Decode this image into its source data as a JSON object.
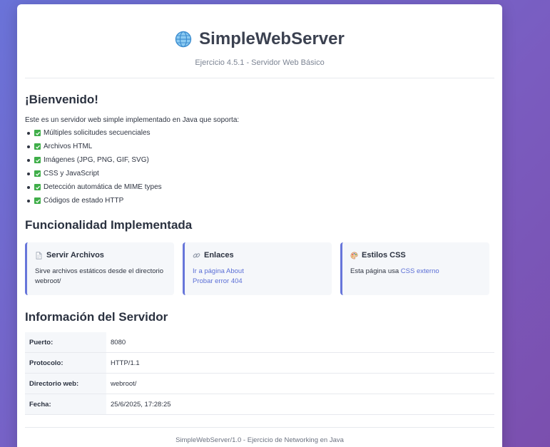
{
  "header": {
    "title": "SimpleWebServer",
    "subtitle": "Ejercicio 4.5.1 - Servidor Web Básico",
    "icon": "globe-icon"
  },
  "welcome": {
    "heading": "¡Bienvenido!",
    "intro": "Este es un servidor web simple implementado en Java que soporta:",
    "features": [
      "Múltiples solicitudes secuenciales",
      "Archivos HTML",
      "Imágenes (JPG, PNG, GIF, SVG)",
      "CSS y JavaScript",
      "Detección automática de MIME types",
      "Códigos de estado HTTP"
    ]
  },
  "functionality": {
    "heading": "Funcionalidad Implementada",
    "cards": [
      {
        "icon": "document-icon",
        "title": "Servir Archivos",
        "text": "Sirve archivos estáticos desde el directorio webroot/"
      },
      {
        "icon": "link-icon",
        "title": "Enlaces",
        "link1": "Ir a página About",
        "link2": "Probar error 404"
      },
      {
        "icon": "palette-icon",
        "title": "Estilos CSS",
        "text": "Esta página usa ",
        "link": "CSS externo"
      }
    ]
  },
  "server_info": {
    "heading": "Información del Servidor",
    "rows": [
      {
        "key": "Puerto:",
        "value": "8080"
      },
      {
        "key": "Protocolo:",
        "value": "HTTP/1.1"
      },
      {
        "key": "Directorio web:",
        "value": "webroot/"
      },
      {
        "key": "Fecha:",
        "value": "25/6/2025, 17:28:25"
      }
    ]
  },
  "footer": {
    "text": "SimpleWebServer/1.0 - Ejercicio de Networking en Java"
  },
  "colors": {
    "accent": "#6776da",
    "link": "#5b6fd6",
    "check": "#3fae49",
    "background_start": "#6a73d8",
    "background_end": "#7b4fae"
  }
}
